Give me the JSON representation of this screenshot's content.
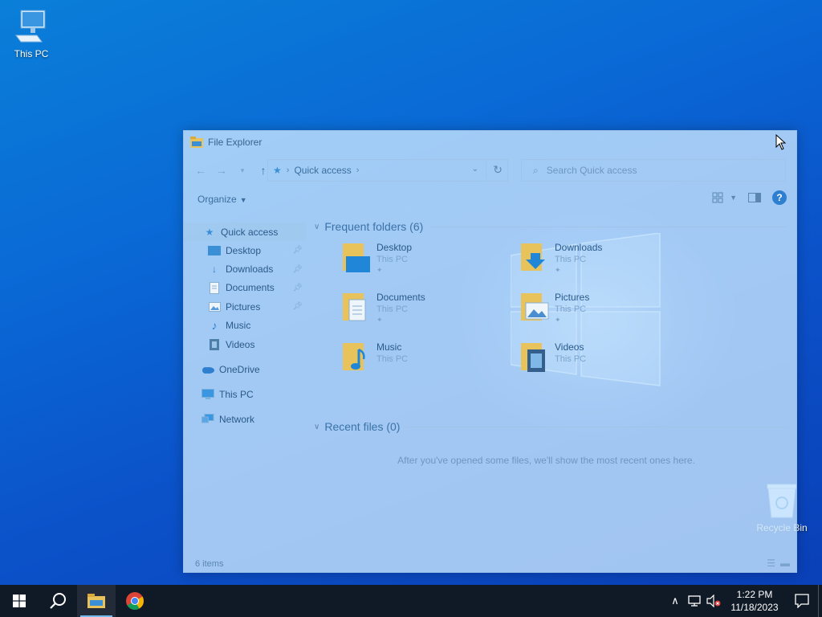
{
  "desktop": {
    "icons": [
      {
        "label": "This PC",
        "icon": "computer-icon"
      },
      {
        "label": "Recycle Bin",
        "icon": "recycle-bin-icon"
      }
    ]
  },
  "explorer": {
    "title": "File Explorer",
    "address": {
      "root_icon": "star-pin-icon",
      "location": "Quick access"
    },
    "search_placeholder": "Search Quick access",
    "organize_label": "Organize",
    "nav": {
      "quick_access": "Quick access",
      "pinned": [
        {
          "label": "Desktop",
          "pinned": true
        },
        {
          "label": "Downloads",
          "pinned": true
        },
        {
          "label": "Documents",
          "pinned": true
        },
        {
          "label": "Pictures",
          "pinned": true
        },
        {
          "label": "Music",
          "pinned": false
        },
        {
          "label": "Videos",
          "pinned": false
        }
      ],
      "onedrive": "OneDrive",
      "this_pc": "This PC",
      "network": "Network"
    },
    "frequent": {
      "heading": "Frequent folders (6)",
      "folders": [
        {
          "name": "Desktop",
          "location": "This PC",
          "pinned": true
        },
        {
          "name": "Downloads",
          "location": "This PC",
          "pinned": true
        },
        {
          "name": "Documents",
          "location": "This PC",
          "pinned": true
        },
        {
          "name": "Pictures",
          "location": "This PC",
          "pinned": true
        },
        {
          "name": "Music",
          "location": "This PC",
          "pinned": false
        },
        {
          "name": "Videos",
          "location": "This PC",
          "pinned": false
        }
      ]
    },
    "recent": {
      "heading": "Recent files (0)",
      "empty_message": "After you've opened some files, we'll show the most recent ones here."
    },
    "status": "6 items"
  },
  "taskbar": {
    "apps": [
      "start-icon",
      "search-icon",
      "file-explorer-icon",
      "chrome-icon"
    ],
    "active_app": "file-explorer-icon",
    "clock": {
      "time": "1:22 PM",
      "date": "11/18/2023"
    }
  },
  "colors": {
    "taskbar_bg": "#101a26",
    "accent": "#2e7fd0",
    "folder_yellow": "#e8c25a"
  }
}
